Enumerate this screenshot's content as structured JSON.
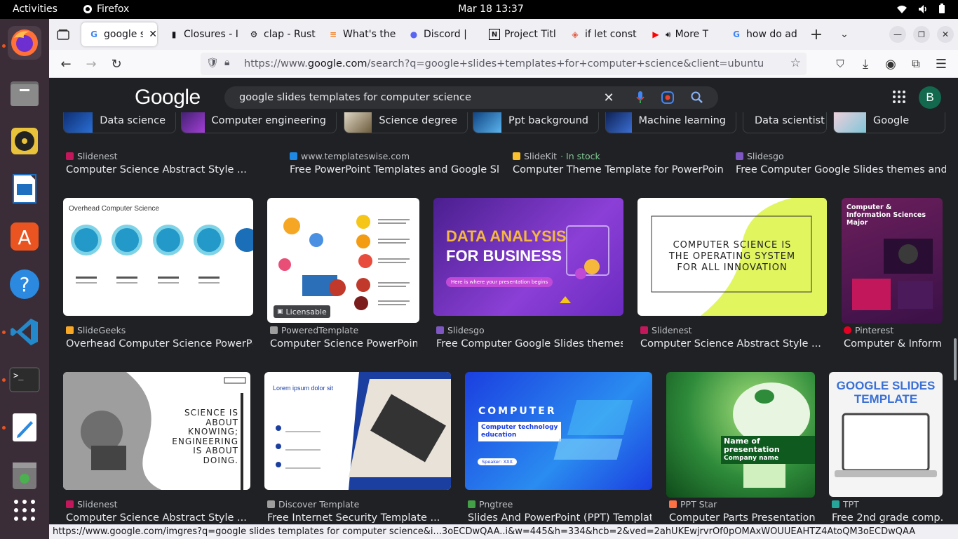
{
  "system": {
    "activities": "Activities",
    "app_name": "Firefox",
    "clock": "Mar 18  13:37"
  },
  "tabs": [
    {
      "title": "google s",
      "favicon": "google-icon",
      "active": true
    },
    {
      "title": "Closures - I",
      "favicon": "book-icon"
    },
    {
      "title": "clap - Rust",
      "favicon": "rust-icon"
    },
    {
      "title": "What's the",
      "favicon": "stackoverflow-icon"
    },
    {
      "title": "Discord | ",
      "favicon": "discord-icon"
    },
    {
      "title": "Project Titl",
      "favicon": "notion-icon"
    },
    {
      "title": "if let const",
      "favicon": "shield-icon"
    },
    {
      "title": "More T",
      "favicon": "youtube-icon"
    },
    {
      "title": "how do ad",
      "favicon": "google-icon"
    }
  ],
  "url": {
    "prefix": "https://www.",
    "host": "google.com",
    "path": "/search?q=google+slides+templates+for+computer+science&client=ubuntu"
  },
  "google": {
    "logo": "Google",
    "query": "google slides templates for computer science",
    "avatar": "B"
  },
  "chips": [
    "Data science",
    "Computer engineering",
    "Science degree",
    "Ppt background",
    "Machine learning",
    "Data scientist",
    "Google"
  ],
  "row0": [
    {
      "source": "Slidenest",
      "title": "Computer Science Abstract Style ...",
      "color": "#c2185b"
    },
    {
      "source": "www.templateswise.com",
      "title": "Free PowerPoint Templates and Google Sli...",
      "color": "#1e88e5"
    },
    {
      "source": "SlideKit",
      "extra": " · In stock",
      "title": "Computer Theme Template for PowerPoint ...",
      "color": "#fbc02d"
    },
    {
      "source": "Slidesgo",
      "title": "Free Computer Google Slides themes and ...",
      "color": "#7e57c2"
    }
  ],
  "row1": [
    {
      "source": "SlideGeeks",
      "title": "Overhead Computer Science PowerPo...",
      "color": "#f9a825"
    },
    {
      "source": "PoweredTemplate",
      "title": "Computer Science PowerPoin...",
      "color": "#9e9e9e"
    },
    {
      "source": "Slidesgo",
      "title": "Free Computer Google Slides themes ...",
      "color": "#7e57c2"
    },
    {
      "source": "Slidenest",
      "title": "Computer Science Abstract Style ...",
      "color": "#c2185b"
    },
    {
      "source": "Pinterest",
      "title": "Computer & Inform...",
      "color": "#e60023"
    }
  ],
  "row2": [
    {
      "source": "Slidenest",
      "title": "Computer Science Abstract Style ...",
      "color": "#c2185b"
    },
    {
      "source": "Discover Template",
      "title": "Free Internet Security Template ...",
      "color": "#9e9e9e"
    },
    {
      "source": "Pngtree",
      "title": "Slides And PowerPoint (PPT) Templat...",
      "color": "#43a047"
    },
    {
      "source": "PPT Star",
      "title": "Computer Parts Presentation ...",
      "color": "#ff7043"
    },
    {
      "source": "TPT",
      "title": "Free 2nd grade comp...",
      "color": "#26a69a"
    }
  ],
  "thumbs": {
    "overhead_title": "Overhead Computer Science",
    "licensable": "Licensable",
    "data_analysis_1": "DATA ANALYSIS",
    "data_analysis_2": "FOR BUSINESS",
    "data_analysis_pill": "Here is where your presentation begins",
    "cs_os": "COMPUTER SCIENCE IS THE OPERATING SYSTEM FOR ALL INNOVATION",
    "cis_title": "Computer & Information Sciences Major",
    "science_quote": "SCIENCE IS ABOUT KNOWING; ENGINEERING IS ABOUT DOING.",
    "lorem": "Lorem ipsum dolor sit",
    "computer": "COMPUTER",
    "computer_tech": "Computer technology education",
    "speaker": "Speaker: XXX",
    "presentation_name": "Name of presentation",
    "company_name": "Company name",
    "gs_template": "GOOGLE SLIDES TEMPLATE"
  },
  "statusbar": "https://www.google.com/imgres?q=google slides templates for computer science&i...3oECDwQAA..i&w=445&h=334&hcb=2&ved=2ahUKEwjrvrOf0pOMAxWOUUEAHTZ4AtoQM3oECDwQAA"
}
